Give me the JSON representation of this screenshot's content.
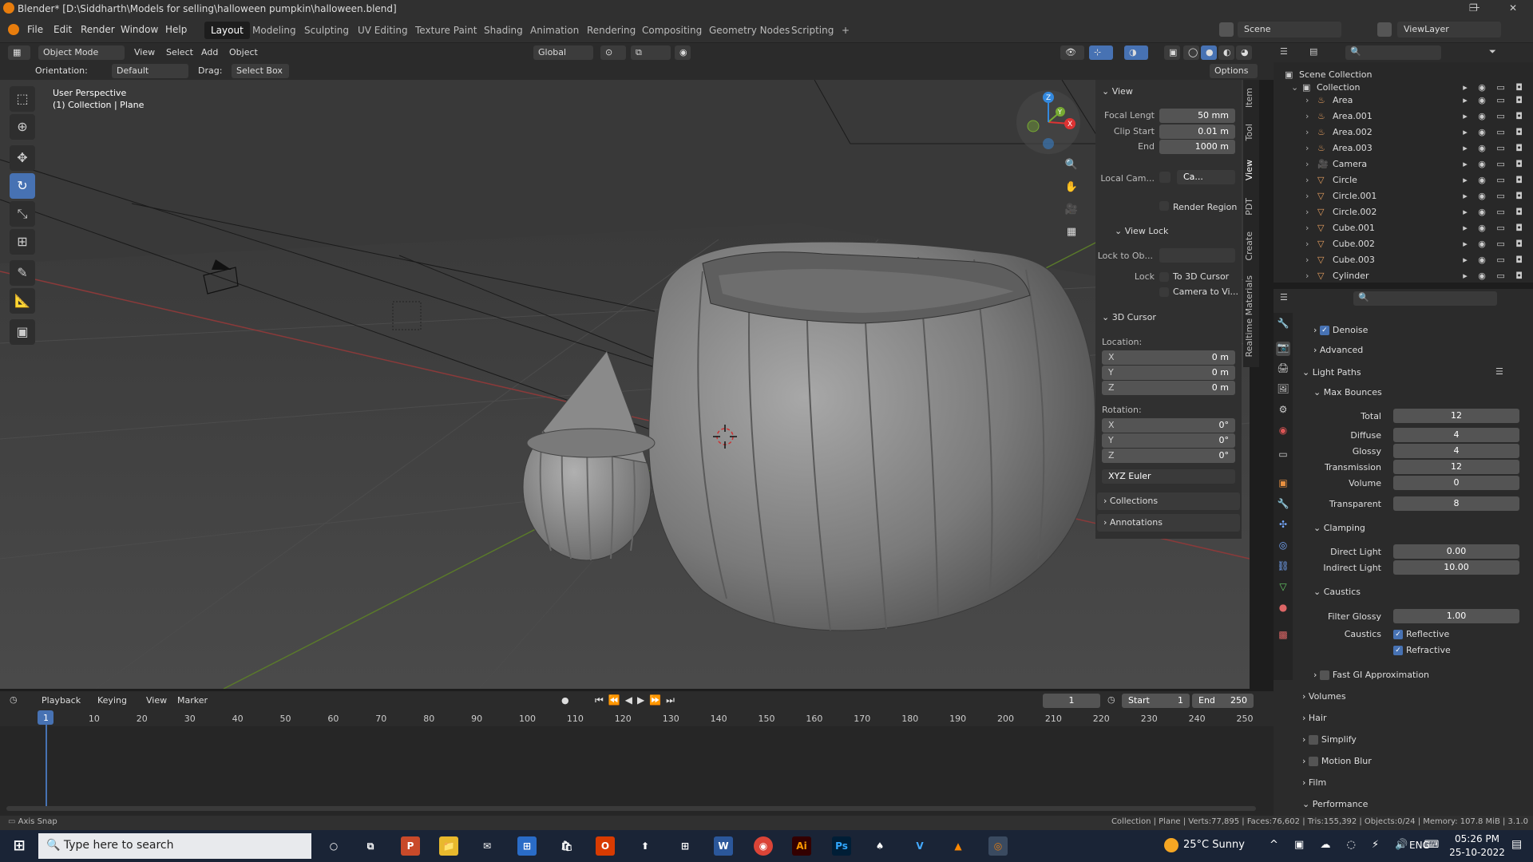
{
  "titlebar": {
    "title": "Blender* [D:\\Siddharth\\Models for selling\\halloween pumpkin\\halloween.blend]",
    "minimize": "—",
    "maximize": "❐",
    "close": "✕"
  },
  "menu": {
    "items": [
      "File",
      "Edit",
      "Render",
      "Window",
      "Help"
    ],
    "workspaces": [
      "Layout",
      "Modeling",
      "Sculpting",
      "UV Editing",
      "Texture Paint",
      "Shading",
      "Animation",
      "Rendering",
      "Compositing",
      "Geometry Nodes",
      "Scripting"
    ],
    "add_tab": "+",
    "scene": "Scene",
    "viewlayer": "ViewLayer"
  },
  "header": {
    "mode": "Object Mode",
    "menus": [
      "View",
      "Select",
      "Add",
      "Object"
    ],
    "transform": "Global",
    "orientation_label": "Orientation:",
    "orientation_value": "Default",
    "drag_label": "Drag:",
    "drag_value": "Select Box",
    "options": "Options"
  },
  "viewport": {
    "perspective": "User Perspective",
    "collection": "(1) Collection | Plane"
  },
  "npanel": {
    "view_title": "View",
    "focal_label": "Focal Lengt",
    "focal_value": "50 mm",
    "clip_start_label": "Clip Start",
    "clip_start_value": "0.01 m",
    "end_label": "End",
    "end_value": "1000 m",
    "local_cam_label": "Local Cam...",
    "local_cam_value": "Ca...",
    "render_region": "Render Region",
    "view_lock_title": "View Lock",
    "lock_to_label": "Lock to Ob...",
    "lock_label": "Lock",
    "to_3d_cursor": "To 3D Cursor",
    "camera_to_view": "Camera to Vi...",
    "cursor_title": "3D Cursor",
    "location_label": "Location:",
    "loc_x": "0 m",
    "loc_y": "0 m",
    "loc_z": "0 m",
    "rotation_label": "Rotation:",
    "rot_x": "0°",
    "rot_y": "0°",
    "rot_z": "0°",
    "rotation_mode": "XYZ Euler",
    "collections": "Collections",
    "annotations": "Annotations",
    "axis_x": "X",
    "axis_y": "Y",
    "axis_z": "Z",
    "vtabs": [
      "Item",
      "Tool",
      "View",
      "PDT",
      "Create",
      "Realtime Materials"
    ]
  },
  "outliner": {
    "scene_collection": "Scene Collection",
    "collection": "Collection",
    "items": [
      "Area",
      "Area.001",
      "Area.002",
      "Area.003",
      "Camera",
      "Circle",
      "Circle.001",
      "Circle.002",
      "Cube.001",
      "Cube.002",
      "Cube.003",
      "Cylinder"
    ],
    "visibility_icons": "▸ ◉ ▭ ◘"
  },
  "properties": {
    "denoise": "Denoise",
    "advanced": "Advanced",
    "light_paths": "Light Paths",
    "max_bounces": "Max Bounces",
    "total_label": "Total",
    "total_value": "12",
    "diffuse_label": "Diffuse",
    "diffuse_value": "4",
    "glossy_label": "Glossy",
    "glossy_value": "4",
    "transmission_label": "Transmission",
    "transmission_value": "12",
    "volume_label": "Volume",
    "volume_value": "0",
    "transparent_label": "Transparent",
    "transparent_value": "8",
    "clamping": "Clamping",
    "direct_light_label": "Direct Light",
    "direct_light_value": "0.00",
    "indirect_light_label": "Indirect Light",
    "indirect_light_value": "10.00",
    "caustics_section": "Caustics",
    "filter_glossy_label": "Filter Glossy",
    "filter_glossy_value": "1.00",
    "caustics_label": "Caustics",
    "reflective": "Reflective",
    "refractive": "Refractive",
    "fast_gi": "Fast GI Approximation",
    "volumes": "Volumes",
    "hair": "Hair",
    "simplify": "Simplify",
    "motion_blur": "Motion Blur",
    "film": "Film",
    "performance": "Performance"
  },
  "timeline": {
    "menus": [
      "Playback",
      "Keying",
      "View",
      "Marker"
    ],
    "current_frame": "1",
    "start_label": "Start",
    "start_value": "1",
    "end_label": "End",
    "end_value": "250",
    "ticks": [
      "1",
      "10",
      "20",
      "30",
      "40",
      "50",
      "60",
      "70",
      "80",
      "90",
      "100",
      "110",
      "120",
      "130",
      "140",
      "150",
      "160",
      "170",
      "180",
      "190",
      "200",
      "210",
      "220",
      "230",
      "240",
      "250"
    ]
  },
  "statusbar": {
    "left": "Axis Snap",
    "right": "Collection | Plane | Verts:77,895 | Faces:76,602 | Tris:155,392 | Objects:0/24 | Memory: 107.8 MiB | 3.1.0"
  },
  "taskbar": {
    "search_placeholder": "Type here to search",
    "weather": "25°C  Sunny",
    "lang": "ENG",
    "time": "05:26 PM",
    "date": "25-10-2022",
    "apps": [
      "P",
      "📁",
      "✉",
      "⊞",
      "🛍",
      "O",
      "⬆",
      "⊞",
      "W",
      "◉",
      "Ai",
      "Ps",
      "♠",
      "V",
      "▲",
      "◎"
    ]
  },
  "colors": {
    "accent": "#4772b3",
    "viewport_bg": "#3d3d3d",
    "blender_orange": "#e87d0d"
  }
}
